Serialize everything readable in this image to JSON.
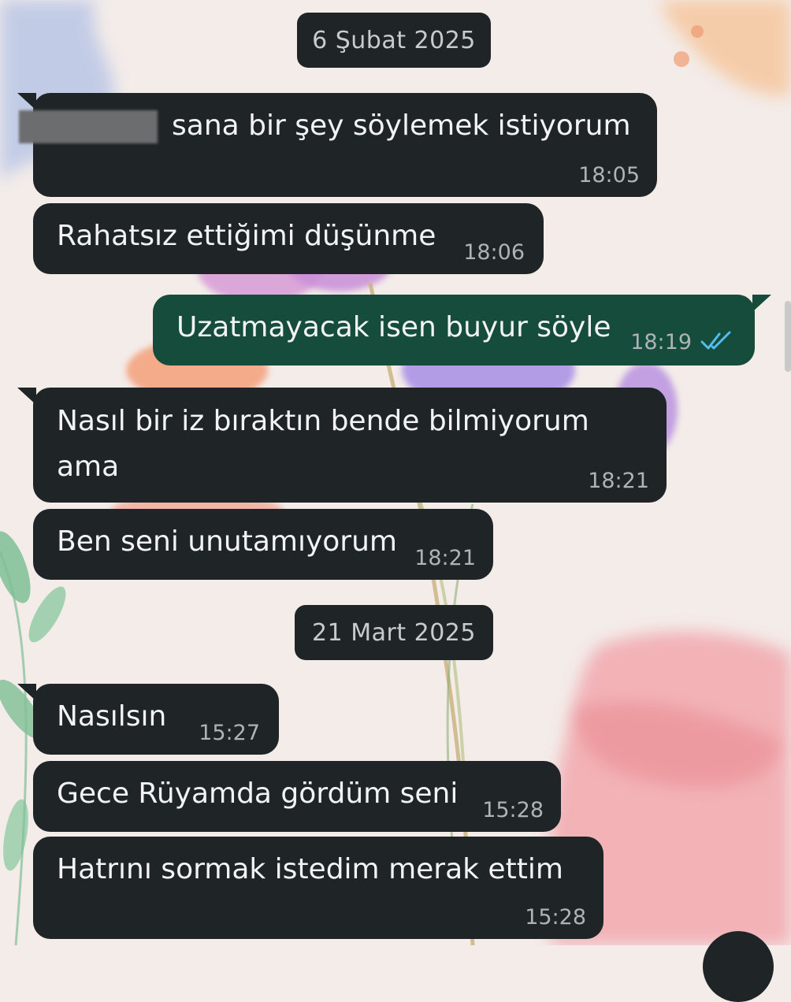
{
  "chat": {
    "date_separators": [
      "6 Şubat 2025",
      "21 Mart 2025"
    ],
    "messages": [
      {
        "direction": "incoming",
        "text": "sana bir şey söylemek istiyorum",
        "time": "18:05",
        "sender_name_redacted": true
      },
      {
        "direction": "incoming",
        "text": "Rahatsız ettiğimi düşünme",
        "time": "18:06"
      },
      {
        "direction": "outgoing",
        "text": "Uzatmayacak isen buyur söyle",
        "time": "18:19",
        "status": "read"
      },
      {
        "direction": "incoming",
        "text_lines": [
          "Nasıl bir iz bıraktın bende bilmiyorum",
          "ama"
        ],
        "time": "18:21"
      },
      {
        "direction": "incoming",
        "text": "Ben seni unutamıyorum",
        "time": "18:21"
      },
      {
        "direction": "incoming",
        "text": "Nasılsın",
        "time": "15:27"
      },
      {
        "direction": "incoming",
        "text": "Gece Rüyamda gördüm seni",
        "time": "15:28"
      },
      {
        "direction": "incoming",
        "text": "Hatrını sormak istedim merak ettim",
        "time": "15:28"
      }
    ]
  },
  "colors": {
    "incoming_bubble": "#1f2527",
    "outgoing_bubble": "#154c3c",
    "read_ticks": "#53bdeb",
    "date_chip": "#1f2527"
  },
  "icons": [
    "double-check-icon"
  ]
}
